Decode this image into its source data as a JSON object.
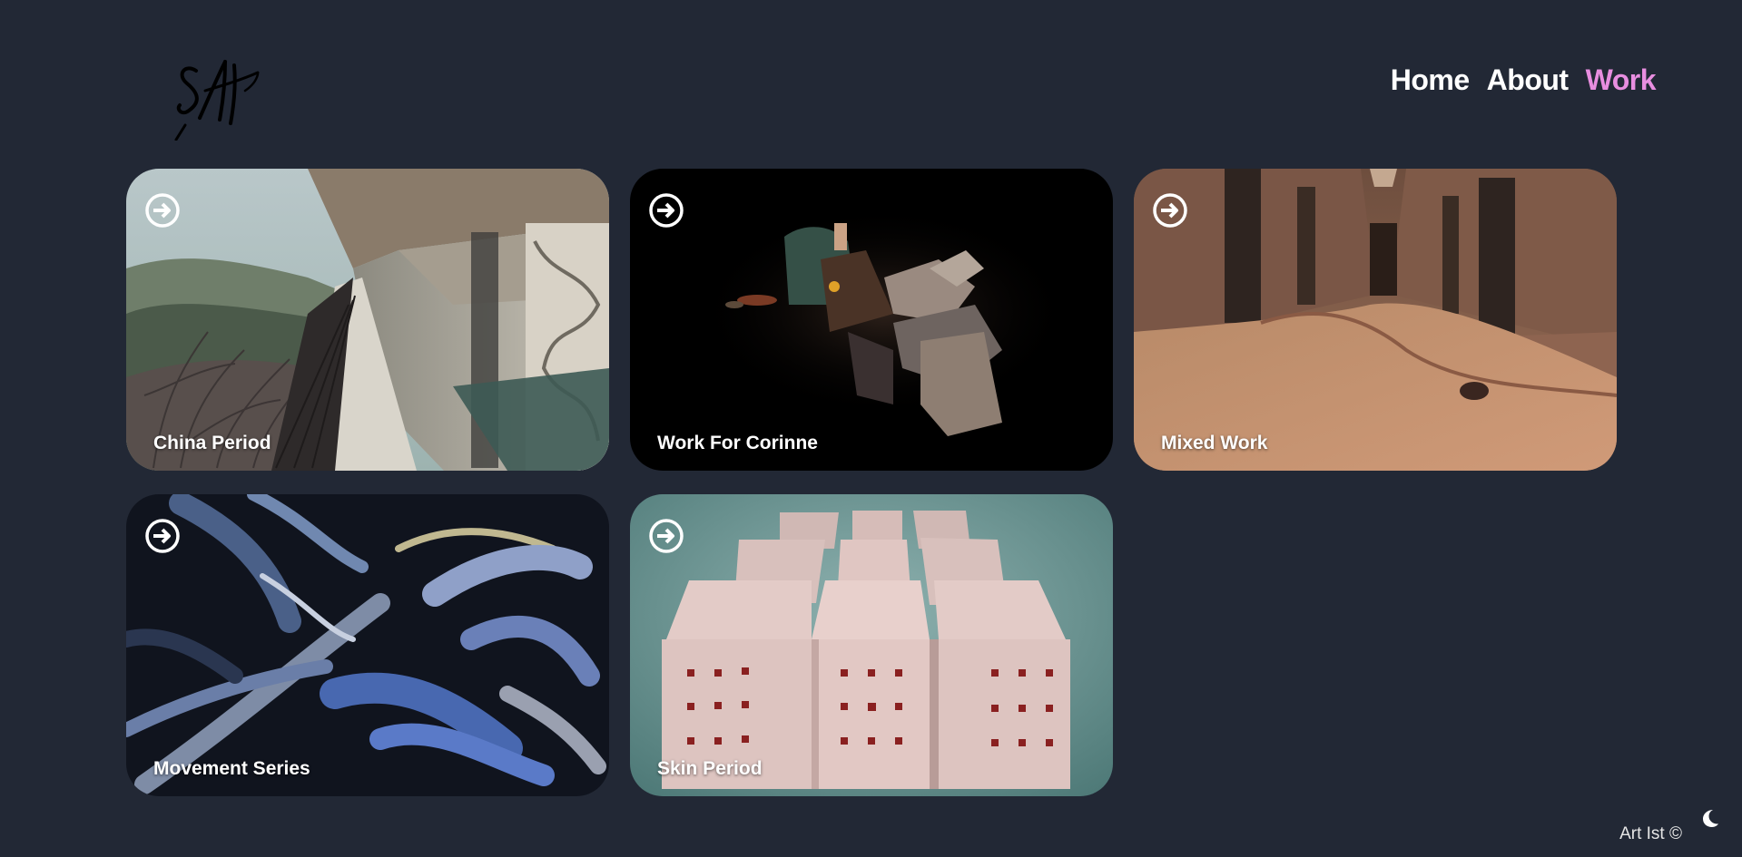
{
  "nav": {
    "items": [
      {
        "label": "Home",
        "active": false
      },
      {
        "label": "About",
        "active": false
      },
      {
        "label": "Work",
        "active": true
      }
    ]
  },
  "cards": [
    {
      "title": "China Period",
      "arrow_icon": "arrow-right-circle-icon"
    },
    {
      "title": "Work For Corinne",
      "arrow_icon": "arrow-right-circle-icon"
    },
    {
      "title": "Mixed Work",
      "arrow_icon": "arrow-right-circle-icon"
    },
    {
      "title": "Movement Series",
      "arrow_icon": "arrow-right-circle-icon"
    },
    {
      "title": "Skin Period",
      "arrow_icon": "arrow-right-circle-icon"
    }
  ],
  "footer": {
    "text": "Art Ist ©",
    "toggle_icon": "moon-icon"
  },
  "colors": {
    "background": "#222835",
    "accent": "#e88ee0",
    "text": "#ffffff"
  }
}
